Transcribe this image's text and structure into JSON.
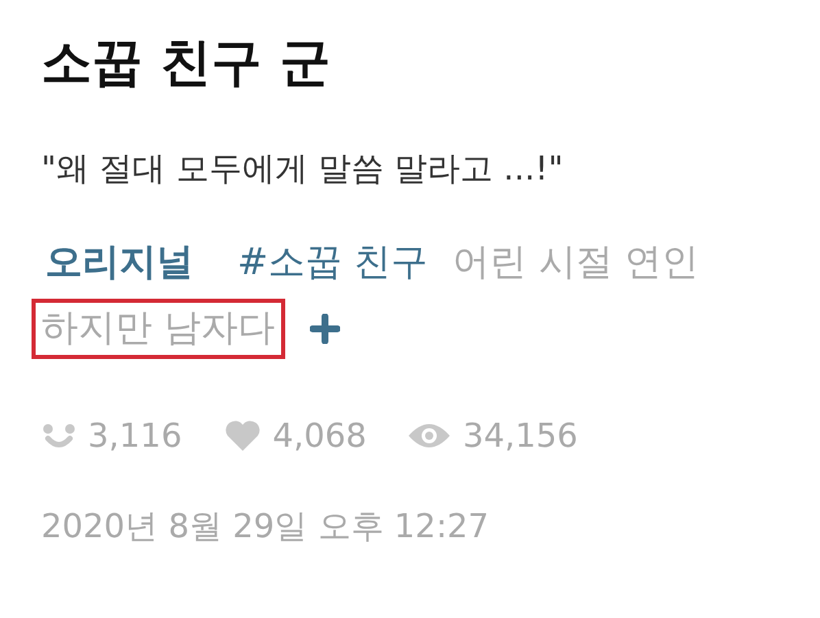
{
  "title": "소꿉 친구 군",
  "caption": "\"왜 절대 모두에게 말씀 말라고 ...!\"",
  "tags": [
    {
      "kind": "original",
      "label": "오리지널",
      "highlighted": false
    },
    {
      "kind": "hashtag",
      "label": "#소꿉 친구",
      "highlighted": false
    },
    {
      "kind": "tag",
      "label": "어린 시절 연인",
      "highlighted": false
    },
    {
      "kind": "tag",
      "label": "하지만 남자다",
      "highlighted": true
    }
  ],
  "stats": [
    {
      "kind": "reactions",
      "value": "3,116"
    },
    {
      "kind": "likes",
      "value": "4,068"
    },
    {
      "kind": "views",
      "value": "34,156"
    }
  ],
  "date": "2020년 8월 29일 오후 12:27"
}
